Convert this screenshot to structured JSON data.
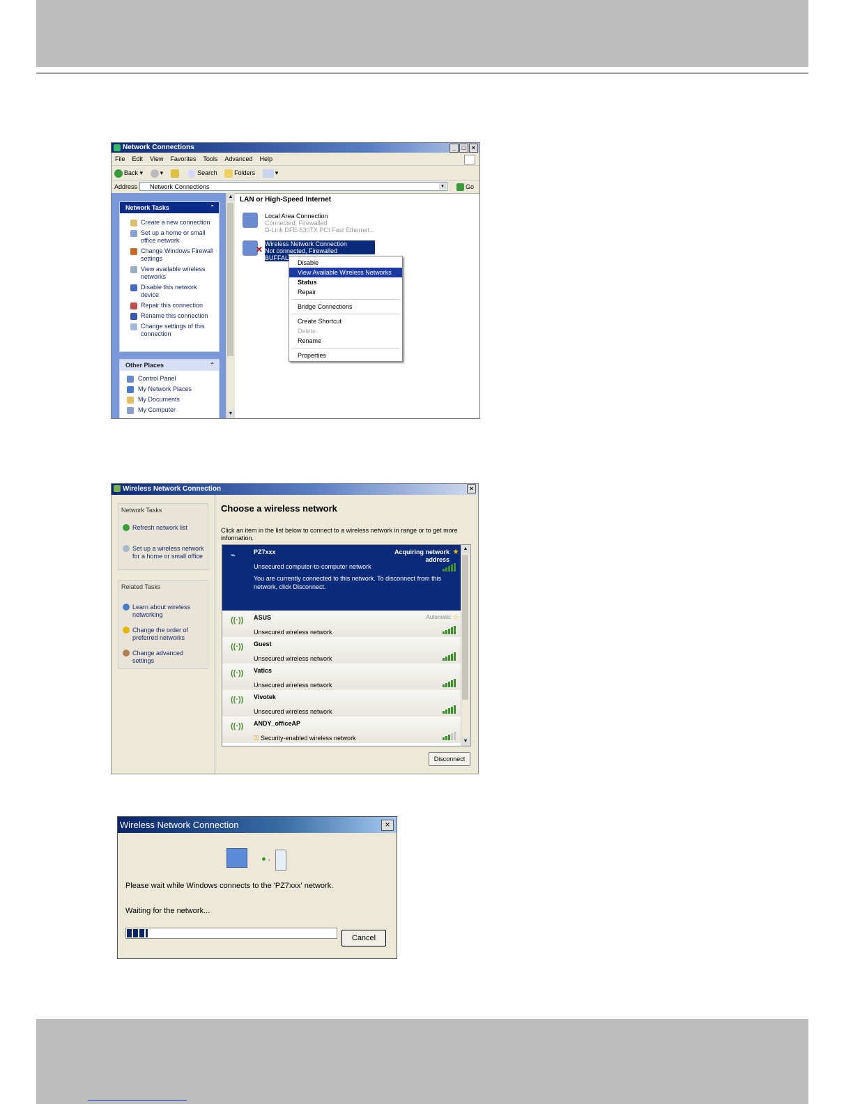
{
  "window1": {
    "title": "Network Connections",
    "menu": [
      "File",
      "Edit",
      "View",
      "Favorites",
      "Tools",
      "Advanced",
      "Help"
    ],
    "toolbar": {
      "back": "Back",
      "search": "Search",
      "folders": "Folders"
    },
    "address": {
      "label": "Address",
      "value": "Network Connections",
      "go": "Go"
    },
    "network_tasks": {
      "title": "Network Tasks",
      "items": [
        "Create a new connection",
        "Set up a home or small office network",
        "Change Windows Firewall settings",
        "View available wireless networks",
        "Disable this network device",
        "Repair this connection",
        "Rename this connection",
        "Change settings of this connection"
      ]
    },
    "other_places": {
      "title": "Other Places",
      "items": [
        "Control Panel",
        "My Network Places",
        "My Documents",
        "My Computer"
      ]
    },
    "section_title": "LAN or High-Speed Internet",
    "connections": [
      {
        "name": "Local Area Connection",
        "status": "Connected, Firewalled",
        "device": "D-Link DFE-530TX PCI Fast Ethernet..."
      },
      {
        "name": "Wireless Network Connection",
        "status": "Not connected, Firewalled",
        "device": "BUFFAL"
      }
    ],
    "context_menu": [
      "Disable",
      "View Available Wireless Networks",
      "Status",
      "Repair",
      "Bridge Connections",
      "Create Shortcut",
      "Delete",
      "Rename",
      "Properties"
    ]
  },
  "window2": {
    "title": "Wireless Network Connection",
    "network_tasks": {
      "title": "Network Tasks",
      "items": [
        "Refresh network list",
        "Set up a wireless network for a home or small office"
      ]
    },
    "related_tasks": {
      "title": "Related Tasks",
      "items": [
        "Learn about wireless networking",
        "Change the order of preferred networks",
        "Change advanced settings"
      ]
    },
    "heading": "Choose a wireless network",
    "description": "Click an item in the list below to connect to a wireless network in range or to get more information.",
    "networks": [
      {
        "name": "PZ7xxx",
        "status": "Acquiring network address",
        "security": "Unsecured computer-to-computer network",
        "note": "You are currently connected to this network. To disconnect from this network, click Disconnect.",
        "signal": 5
      },
      {
        "name": "ASUS",
        "status": "Automatic",
        "security": "Unsecured wireless network",
        "signal": 5
      },
      {
        "name": "Guest",
        "security": "Unsecured wireless network",
        "signal": 5
      },
      {
        "name": "Vatics",
        "security": "Unsecured wireless network",
        "signal": 5
      },
      {
        "name": "Vivotek",
        "security": "Unsecured wireless network",
        "signal": 5
      },
      {
        "name": "ANDY_officeAP",
        "security": "Security-enabled wireless network",
        "signal": 3
      }
    ],
    "disconnect_label": "Disconnect"
  },
  "window3": {
    "title": "Wireless Network Connection",
    "message": "Please wait while Windows connects to the 'PZ7xxx' network.",
    "waiting": "Waiting for the network...",
    "progress": 0.1,
    "cancel_label": "Cancel"
  },
  "colors": {
    "title_bar": "#0b2a7a",
    "selection": "#0a2a7a",
    "signal": "#3f8f2f",
    "page_band": "#bdbdbd"
  }
}
